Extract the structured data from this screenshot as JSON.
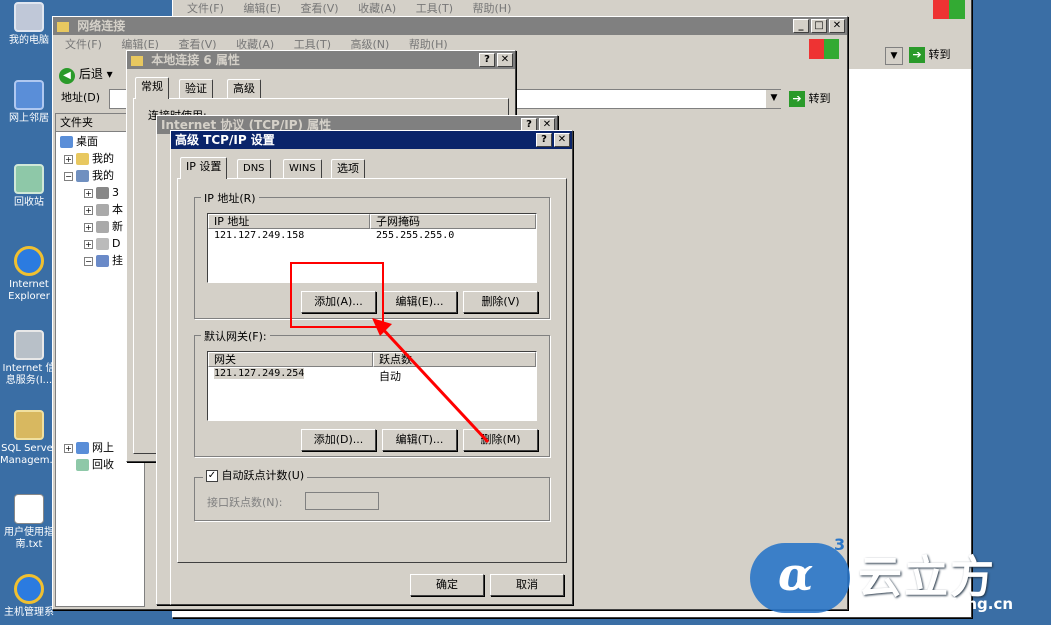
{
  "desktop": {
    "icons": [
      "我的电脑",
      "网上邻居",
      "回收站",
      "Internet Explorer",
      "Internet 信息服务(I...",
      "SQL Server Managem...",
      "用户使用指南.txt",
      "主机管理系"
    ]
  },
  "ie_window": {
    "menu": [
      "文件(F)",
      "编辑(E)",
      "查看(V)",
      "收藏(A)",
      "工具(T)",
      "帮助(H)"
    ],
    "go": "转到"
  },
  "net_window": {
    "title": "网络连接",
    "menu": [
      "文件(F)",
      "编辑(E)",
      "查看(V)",
      "收藏(A)",
      "工具(T)",
      "高级(N)",
      "帮助(H)"
    ],
    "back": "后退",
    "address_label": "地址(D)",
    "go": "转到"
  },
  "folders": {
    "header": "文件夹",
    "items": [
      "桌面",
      "我的",
      "我的",
      "3",
      "本",
      "新",
      "D",
      "挂",
      "网上",
      "回收"
    ]
  },
  "local_conn": {
    "title": "本地连接 6 属性",
    "tabs": [
      "常规",
      "验证",
      "高级"
    ],
    "label": "连接时使用:"
  },
  "tcpip": {
    "title": "Internet 协议 (TCP/IP) 属性"
  },
  "adv": {
    "title": "高级 TCP/IP 设置",
    "tabs": [
      "IP 设置",
      "DNS",
      "WINS",
      "选项"
    ],
    "ip_group": "IP 地址(R)",
    "ip_cols": [
      "IP 地址",
      "子网掩码"
    ],
    "ip_rows": [
      [
        "121.127.249.158",
        "255.255.255.0"
      ]
    ],
    "ip_buttons": [
      "添加(A)...",
      "编辑(E)...",
      "删除(V)"
    ],
    "gw_group": "默认网关(F):",
    "gw_cols": [
      "网关",
      "跃点数"
    ],
    "gw_rows": [
      [
        "121.127.249.254",
        "自动"
      ]
    ],
    "gw_buttons": [
      "添加(D)...",
      "编辑(T)...",
      "删除(M)"
    ],
    "auto_metric": "自动跃点计数(U)",
    "iface_metric": "接口跃点数(N):",
    "ok": "确定",
    "cancel": "取消"
  },
  "watermark": {
    "brand": "云立方",
    "url": "www.yunlifang.cn",
    "sup": "3"
  },
  "colors": {
    "desktop": "#3a6ea5",
    "title_active": "#0a246a",
    "highlight": "#ff0000"
  }
}
